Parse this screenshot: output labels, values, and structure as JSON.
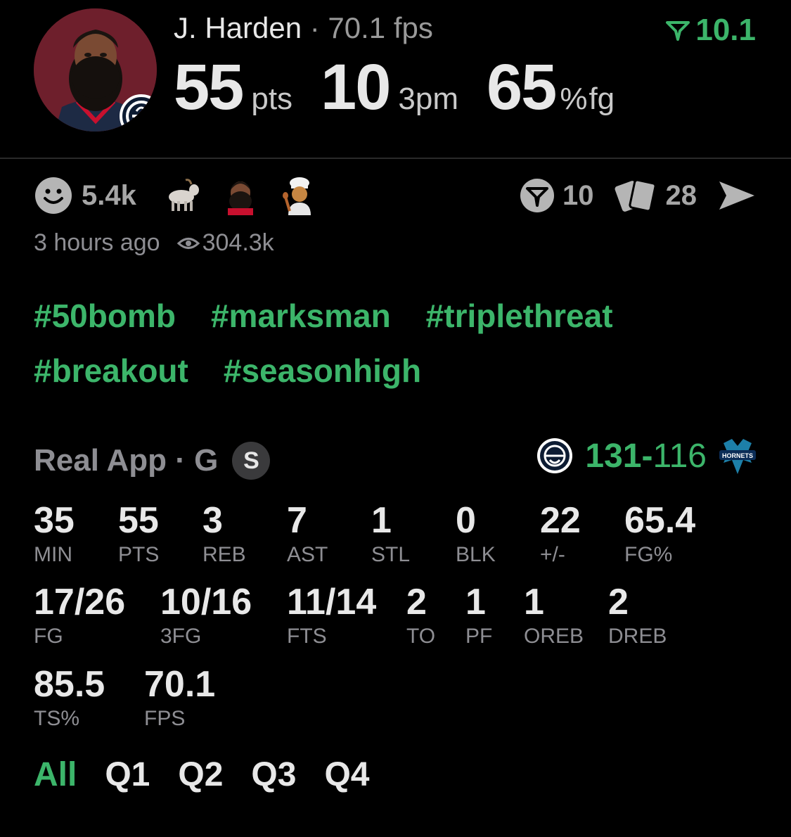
{
  "player": {
    "name": "J. Harden",
    "fps_text": "70.1 fps",
    "score_delta": "10.1"
  },
  "headline": {
    "pts_value": "55",
    "pts_unit": "pts",
    "threes_value": "10",
    "threes_unit": "3pm",
    "fg_value": "65",
    "fg_unit_pct": "%",
    "fg_unit": "fg"
  },
  "reactions": {
    "count": "5.4k",
    "emojis": [
      "smiley-icon",
      "goat-emoji",
      "player-face-emoji",
      "chef-emoji"
    ],
    "predictions_count": "10",
    "cards_count": "28"
  },
  "meta": {
    "time_ago": "3 hours ago",
    "views": "304.3k"
  },
  "hashtags": [
    "#50bomb",
    "#marksman",
    "#triplethreat",
    "#breakout",
    "#seasonhigh"
  ],
  "game": {
    "source": "Real App",
    "position": "G",
    "badge": "S",
    "team_score": "131",
    "opp_score": "116",
    "score_sep": "-",
    "opp_logo_text": "HORNETS"
  },
  "stats": [
    {
      "value": "35",
      "label": "MIN"
    },
    {
      "value": "55",
      "label": "PTS"
    },
    {
      "value": "3",
      "label": "REB"
    },
    {
      "value": "7",
      "label": "AST"
    },
    {
      "value": "1",
      "label": "STL"
    },
    {
      "value": "0",
      "label": "BLK"
    },
    {
      "value": "22",
      "label": "+/-"
    },
    {
      "value": "65.4",
      "label": "FG%"
    },
    {
      "value": "17/26",
      "label": "FG"
    },
    {
      "value": "10/16",
      "label": "3FG"
    },
    {
      "value": "11/14",
      "label": "FTS"
    },
    {
      "value": "2",
      "label": "TO"
    },
    {
      "value": "1",
      "label": "PF"
    },
    {
      "value": "1",
      "label": "OREB"
    },
    {
      "value": "2",
      "label": "DREB"
    },
    {
      "value": "85.5",
      "label": "TS%"
    },
    {
      "value": "70.1",
      "label": "FPS"
    }
  ],
  "tabs": [
    "All",
    "Q1",
    "Q2",
    "Q3",
    "Q4"
  ],
  "colors": {
    "accent_green": "#3cb56a",
    "background": "#000000",
    "muted": "#8e8e93"
  }
}
